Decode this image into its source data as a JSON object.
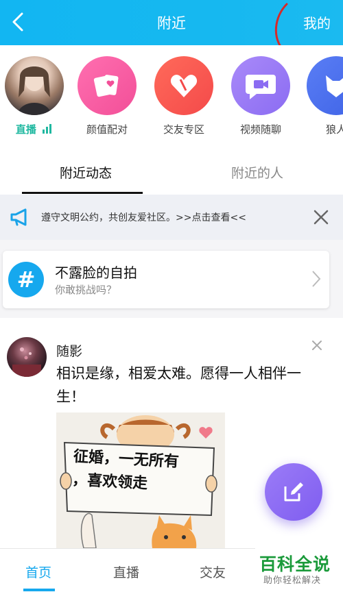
{
  "header": {
    "title": "附近",
    "right_label": "我的"
  },
  "shortcuts": [
    {
      "label": "直播",
      "icon": "live-avatar"
    },
    {
      "label": "颜值配对",
      "icon": "cards-icon"
    },
    {
      "label": "交友专区",
      "icon": "hearts-icon"
    },
    {
      "label": "视频随聊",
      "icon": "video-chat-icon"
    },
    {
      "label": "狼人",
      "icon": "wolf-icon"
    }
  ],
  "tabs": [
    {
      "label": "附近动态",
      "active": true
    },
    {
      "label": "附近的人",
      "active": false
    }
  ],
  "notice": {
    "text": "遵守文明公约，共创友爱社区。>>点击查看<<"
  },
  "topic": {
    "icon": "#",
    "title": "不露脸的自拍",
    "subtitle": "你敢挑战吗？"
  },
  "post": {
    "author": "随影",
    "text": "相识是缘，相爱太难。愿得一人相伴一生！",
    "image_sign_text_line1": "征婚，一无所有",
    "image_sign_text_line2": "，喜欢领走"
  },
  "bottom_nav": [
    {
      "label": "首页",
      "active": true
    },
    {
      "label": "直播",
      "active": false
    },
    {
      "label": "交友",
      "active": false
    }
  ],
  "watermark": {
    "main": "百科全说",
    "sub": "助你轻松解决"
  },
  "colors": {
    "header": "#16b8f0",
    "accent": "#16a8ee",
    "live_green": "#1fb8a0",
    "fab": "#8a6cf4"
  }
}
